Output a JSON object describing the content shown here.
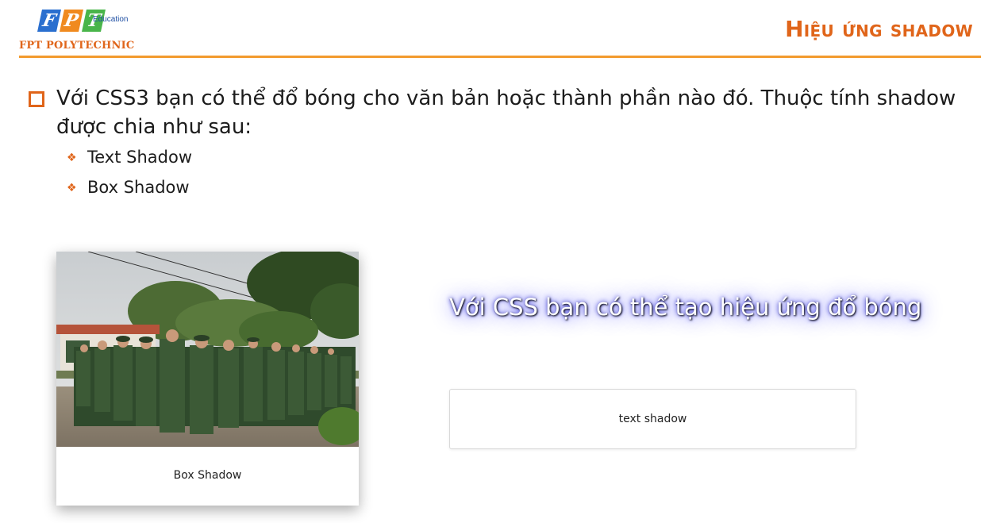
{
  "header": {
    "logo_letters": [
      "F",
      "P",
      "T"
    ],
    "logo_education": "Education",
    "logo_poly": "FPT POLYTECHNIC",
    "slide_title": "Hiệu ứng shadow",
    "accent_color": "#e0651a"
  },
  "content": {
    "intro": "Với CSS3 bạn có thể đổ bóng cho văn bản hoặc thành phần nào đó. Thuộc tính shadow được chia như sau:",
    "bullets": [
      "Text Shadow",
      "Box Shadow"
    ]
  },
  "demo": {
    "card_caption": "Box Shadow",
    "shadow_text": "Với CSS bạn có thể tạo hiệu ứng đổ bóng",
    "box_label": "text shadow"
  }
}
